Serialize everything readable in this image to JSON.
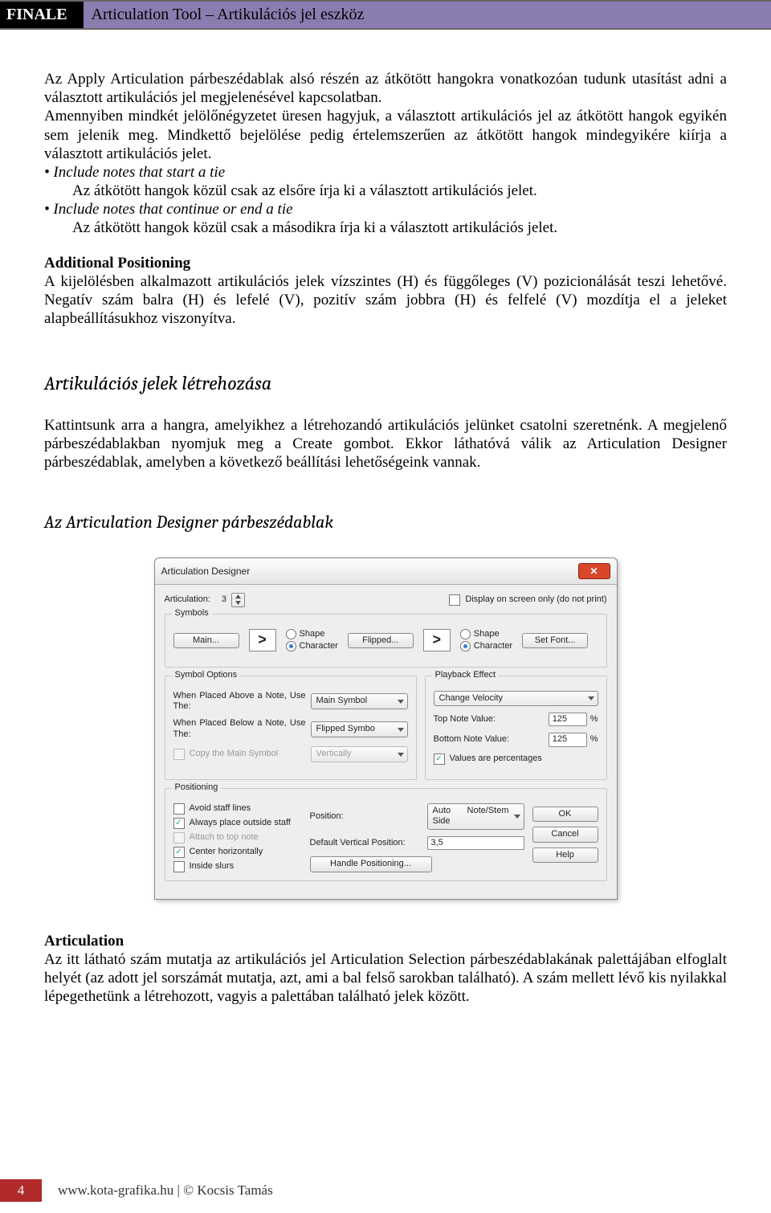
{
  "header": {
    "brand": "FINALE",
    "title": "Articulation Tool – Artikulációs jel eszköz"
  },
  "body": {
    "p1": "Az Apply Articulation párbeszédablak alsó részén az átkötött hangokra vonatkozóan tudunk utasítást adni a választott artikulációs jel megjelenésével kapcsolatban.",
    "p2": "Amennyiben mindkét jelölőnégyzetet üresen hagyjuk, a választott artikulációs jel az átkötött hangok egyikén sem jelenik meg. Mindkettő bejelölése pedig értelemszerűen az átkötött hangok mindegyikére kiírja a választott artikulációs jelet.",
    "b1": "• Include notes that start a tie",
    "b1d": "Az átkötött hangok közül csak az elsőre írja ki a választott artikulációs jelet.",
    "b2": "• Include notes that continue or end a tie",
    "b2d": "Az átkötött hangok közül csak a másodikra írja ki a választott artikulációs jelet.",
    "ap_h": "Additional Positioning",
    "ap_t": "A kijelölésben alkalmazott artikulációs jelek vízszintes (H) és függőleges (V) pozicionálását teszi lehetővé. Negatív szám balra (H) és lefelé (V), pozitív szám jobbra (H) és felfelé (V) mozdítja el a jeleket alapbeállításukhoz viszonyítva.",
    "h2": "Artikulációs jelek létrehozása",
    "p3": "Kattintsunk arra a hangra, amelyikhez a létrehozandó artikulációs jelünket csatolni szeretnénk. A megjelenő párbeszédablakban nyomjuk meg a Create gombot. Ekkor láthatóvá válik az Articulation Designer párbeszédablak, amelyben a következő beállítási lehetőségeink vannak.",
    "h3": "Az Articulation Designer párbeszédablak",
    "art_h": "Articulation",
    "art_t": "Az itt látható szám mutatja az artikulációs jel Articulation Selection párbeszédablakának palettájában elfoglalt helyét (az adott jel sorszámát mutatja, azt, ami a bal felső sarokban található). A szám mellett lévő kis nyilakkal lépegethetünk a létrehozott, vagyis a palettában található jelek között."
  },
  "dlg": {
    "title": "Articulation Designer",
    "art_label": "Articulation:",
    "art_value": "3",
    "disp": "Display on screen only (do not print)",
    "symbols": "Symbols",
    "main": "Main...",
    "flipped": "Flipped...",
    "setfont": "Set Font...",
    "shape": "Shape",
    "character": "Character",
    "glyph": ">",
    "symopt": "Symbol Options",
    "above": "When Placed Above a Note, Use The:",
    "above_v": "Main Symbol",
    "below": "When Placed Below a Note, Use The:",
    "below_v": "Flipped Symbo",
    "copy": "Copy the Main Symbol",
    "vert": "Vertically",
    "pb": "Playback Effect",
    "pb_v": "Change Velocity",
    "top": "Top Note Value:",
    "top_v": "125",
    "pct": "%",
    "bot": "Bottom Note Value:",
    "bot_v": "125",
    "valpct": "Values are percentages",
    "pos": "Positioning",
    "avoid": "Avoid staff lines",
    "always": "Always place outside staff",
    "attach": "Attach to top note",
    "center": "Center horizontally",
    "inside": "Inside slurs",
    "poslbl": "Position:",
    "posv": "Auto Note/Stem Side",
    "defv": "Default Vertical Position:",
    "defvv": "3,5",
    "handle": "Handle Positioning...",
    "ok": "OK",
    "cancel": "Cancel",
    "help": "Help"
  },
  "footer": {
    "page": "4",
    "text": "www.kota-grafika.hu | © Kocsis Tamás"
  }
}
